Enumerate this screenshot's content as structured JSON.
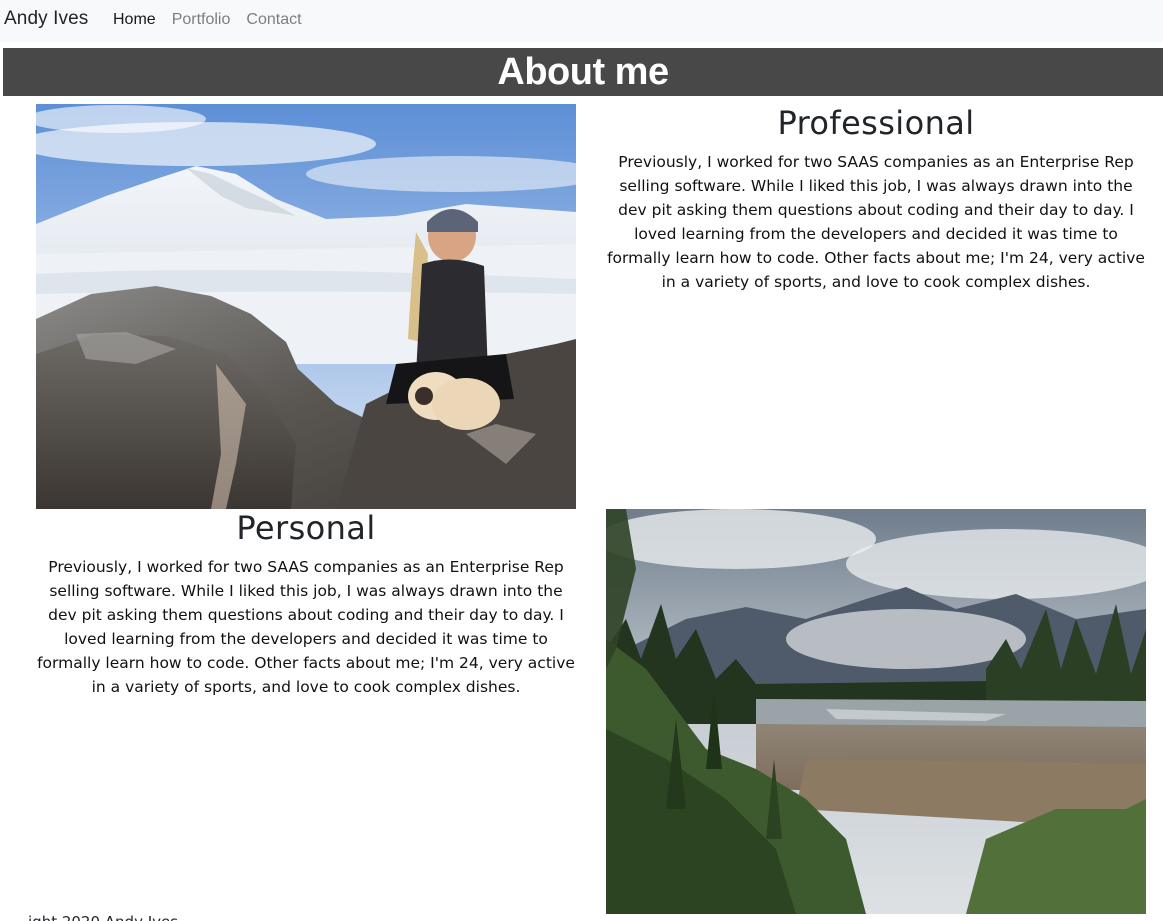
{
  "navbar": {
    "brand": "Andy Ives",
    "links": [
      {
        "label": "Home"
      },
      {
        "label": "Portfolio"
      },
      {
        "label": "Contact"
      }
    ]
  },
  "header": {
    "title": "About me"
  },
  "sections": {
    "professional": {
      "heading": "Professional",
      "body": "Previously, I worked for two SAAS companies as an Enterprise Rep selling software. While I liked this job, I was always drawn into the dev pit asking them questions about coding and their day to day. I loved learning from the developers and decided it was time to formally learn how to code. Other facts about me; I'm 24, very active in a variety of sports, and love to cook complex dishes."
    },
    "personal": {
      "heading": "Personal",
      "body": "Previously, I worked for two SAAS companies as an Enterprise Rep selling software. While I liked this job, I was always drawn into the dev pit asking them questions about coding and their day to day. I loved learning from the developers and decided it was time to formally learn how to code. Other facts about me; I'm 24, very active in a variety of sports, and love to cook complex dishes."
    }
  },
  "footer": {
    "text": "ight 2020 Andy Ives"
  },
  "colors": {
    "navbar_bg": "#f8f9fa",
    "header_band_bg": "#484848",
    "header_text": "#ffffff"
  }
}
